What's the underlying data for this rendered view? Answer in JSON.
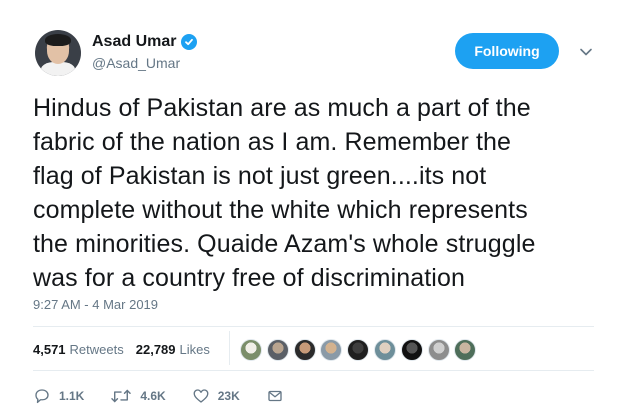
{
  "author": {
    "display_name": "Asad Umar",
    "handle": "@Asad_Umar",
    "verified_icon": "verified-badge-icon"
  },
  "follow_button": {
    "label": "Following"
  },
  "tweet": {
    "lines": [
      "Hindus of Pakistan are as much a part of the",
      "fabric of the nation as I am. Remember the",
      "flag of Pakistan is not just green....its not",
      "complete without the white which represents",
      "the minorities. Quaide Azam's whole struggle",
      "was for a country free of discrimination"
    ],
    "timestamp": "9:27 AM - 4 Mar 2019"
  },
  "stats": {
    "retweets_count": "4,571",
    "retweets_label": "Retweets",
    "likes_count": "22,789",
    "likes_label": "Likes"
  },
  "likers": [
    {
      "colors": [
        "#7b8e6a",
        "#f1efe8"
      ]
    },
    {
      "colors": [
        "#5a5f66",
        "#b8a48f"
      ]
    },
    {
      "colors": [
        "#2b2b2b",
        "#c79a78"
      ]
    },
    {
      "colors": [
        "#8a9aa7",
        "#d3b28f"
      ]
    },
    {
      "colors": [
        "#1f1f1f",
        "#3e3e3e"
      ]
    },
    {
      "colors": [
        "#6e8f9a",
        "#e0d0c0"
      ]
    },
    {
      "colors": [
        "#111111",
        "#555555"
      ]
    },
    {
      "colors": [
        "#8d8d8d",
        "#cfcfcf"
      ]
    },
    {
      "colors": [
        "#4e6e5a",
        "#c8b5a0"
      ]
    }
  ],
  "actions": {
    "reply_count": "1.1K",
    "retweet_count": "4.6K",
    "like_count": "23K"
  },
  "colors": {
    "accent": "#1da1f2",
    "secondary_text": "#657786",
    "divider": "#e6ecf0"
  }
}
